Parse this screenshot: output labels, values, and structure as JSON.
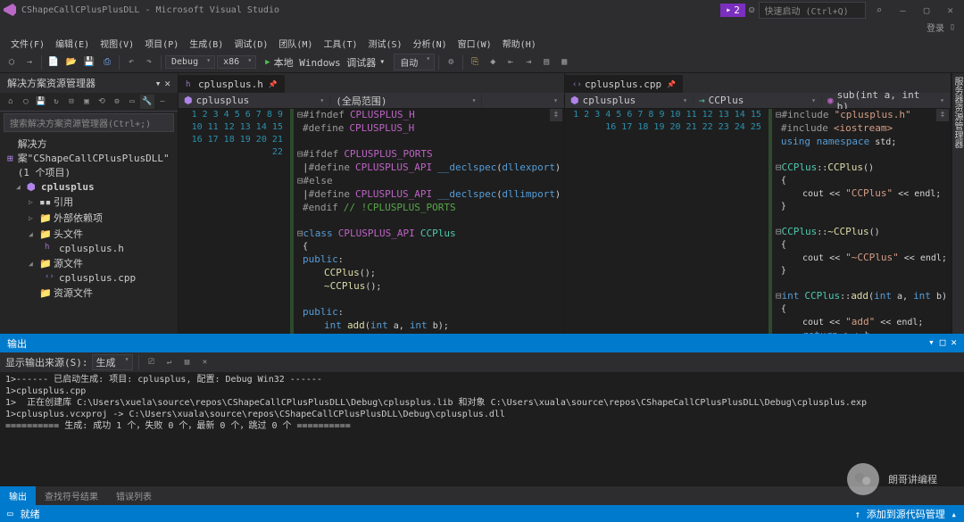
{
  "title": "CShapeCallCPlusPlusDLL - Microsoft Visual Studio",
  "notifications_count": "2",
  "quick_launch_placeholder": "快速启动 (Ctrl+Q)",
  "login_text": "登录",
  "menu": [
    "文件(F)",
    "编辑(E)",
    "视图(V)",
    "项目(P)",
    "生成(B)",
    "调试(D)",
    "团队(M)",
    "工具(T)",
    "测试(S)",
    "分析(N)",
    "窗口(W)",
    "帮助(H)"
  ],
  "toolbar": {
    "config": "Debug",
    "platform": "x86",
    "start_label": "本地 Windows 调试器",
    "process": "自动"
  },
  "solution_explorer": {
    "title": "解决方案资源管理器",
    "search_placeholder": "搜索解决方案资源管理器(Ctrl+;)",
    "solution_label": "解决方案\"CShapeCallCPlusPlusDLL\"(1 个项目)",
    "project": "cplusplus",
    "nodes": {
      "references": "引用",
      "external": "外部依赖项",
      "headers": "头文件",
      "header_file": "cplusplus.h",
      "sources": "源文件",
      "source_file": "cplusplus.cpp",
      "resources": "资源文件"
    }
  },
  "editor_left": {
    "tab": "cplusplus.h",
    "nav_scope": "cplusplus",
    "nav_member": "(全局范围)",
    "lines": [
      1,
      2,
      3,
      4,
      5,
      6,
      7,
      8,
      9,
      10,
      11,
      12,
      13,
      14,
      15,
      16,
      17,
      18,
      19,
      20,
      21,
      22
    ]
  },
  "editor_right": {
    "tab": "cplusplus.cpp",
    "nav_scope": "cplusplus",
    "nav_class": "CCPlus",
    "nav_member": "sub(int a, int b)",
    "lines": [
      1,
      2,
      3,
      4,
      5,
      6,
      7,
      8,
      9,
      10,
      11,
      12,
      13,
      14,
      15,
      16,
      17,
      18,
      19,
      20,
      21,
      22,
      23,
      24,
      25
    ]
  },
  "output": {
    "title": "输出",
    "source_label": "显示输出来源(S):",
    "source_value": "生成",
    "text": "1>------ 已启动生成: 项目: cplusplus, 配置: Debug Win32 ------\n1>cplusplus.cpp\n1>  正在创建库 C:\\Users\\xuela\\source\\repos\\CShapeCallCPlusPlusDLL\\Debug\\cplusplus.lib 和对象 C:\\Users\\xuala\\source\\repos\\CShapeCallCPlusPlusDLL\\Debug\\cplusplus.exp\n1>cplusplus.vcxproj -> C:\\Users\\xuala\\source\\repos\\CShapeCallCPlusPlusDLL\\Debug\\cplusplus.dll\n========== 生成: 成功 1 个，失败 0 个，最新 0 个，跳过 0 个 =========="
  },
  "bottom_tabs": {
    "output": "输出",
    "find": "查找符号结果",
    "errors": "错误列表"
  },
  "status": {
    "ready": "就绪",
    "src_ctrl": "添加到源代码管理"
  },
  "right_panel": "服务器资源管理器",
  "watermark": "朗哥讲编程",
  "code_h": "<span class='pp'>⊟#ifndef</span> <span class='mc'>CPLUSPLUS_H</span>\n <span class='pp'>#define</span> <span class='mc'>CPLUSPLUS_H</span>\n\n<span class='pp'>⊟#ifdef</span> <span class='mc'>CPLUSPLUS_PORTS</span>\n <span class='op'>|</span><span class='pp'>#define</span> <span class='mc'>CPLUSPLUS_API</span> <span class='kw'>__declspec</span>(<span class='kw'>dllexport</span>)\n<span class='pp'>⊟#else</span>\n <span class='op'>|</span><span class='pp'>#define</span> <span class='mc'>CPLUSPLUS_API</span> <span class='kw'>__declspec</span>(<span class='kw'>dllimport</span>)\n <span class='pp'>#endif</span> <span class='cm'>// !CPLUSPLUS_PORTS</span>\n\n<span class='pp'>⊟</span><span class='kw'>class</span> <span class='mc'>CPLUSPLUS_API</span> <span class='tp'>CCPlus</span>\n {\n <span class='kw'>public</span>:\n     <span class='fn'>CCPlus</span>();\n     <span class='fn'>~CCPlus</span>();\n\n <span class='kw'>public</span>:\n     <span class='kw'>int</span> <span class='fn'>add</span>(<span class='kw'>int</span> a, <span class='kw'>int</span> b);\n     <span class='kw'>int</span> <span class='fn'>sub</span>(<span class='kw'>int</span> a, <span class='kw'>int</span> b);\n };\n\n <span class='pp'>#endif</span> <span class='cm'>// !CPLUSPLUS_H</span>",
  "code_cpp": "<span class='pp'>⊟#include</span> <span class='st'>\"cplusplus.h\"</span>\n <span class='pp'>#include</span> <span class='st'>&lt;iostream&gt;</span>\n <span class='kw'>using namespace</span> std;\n\n<span class='pp'>⊟</span><span class='tp'>CCPlus</span>::<span class='fn'>CCPlus</span>()\n {\n     cout &lt;&lt; <span class='st'>\"CCPlus\"</span> &lt;&lt; endl;\n }\n\n<span class='pp'>⊟</span><span class='tp'>CCPlus</span>::<span class='fn'>~CCPlus</span>()\n {\n     cout &lt;&lt; <span class='st'>\"~CCPlus\"</span> &lt;&lt; endl;\n }\n\n<span class='pp'>⊟</span><span class='kw'>int</span> <span class='tp'>CCPlus</span>::<span class='fn'>add</span>(<span class='kw'>int</span> a, <span class='kw'>int</span> b)\n {\n     cout &lt;&lt; <span class='st'>\"add\"</span> &lt;&lt; endl;\n     <span class='kw'>return</span> a + b;\n }\n\n<span class='pp'>⊟</span><span class='kw'>int</span> <span class='tp'>CCPlus</span>::<span class='fn'>sub</span>(<span class='kw'>int</span> a, <span class='kw'>int</span> b)\n {\n     cout &lt;&lt; <span class='st'>\"sub\"</span> &lt;&lt; endl;\n     <span class='kw'>return</span> a - b;\n }"
}
